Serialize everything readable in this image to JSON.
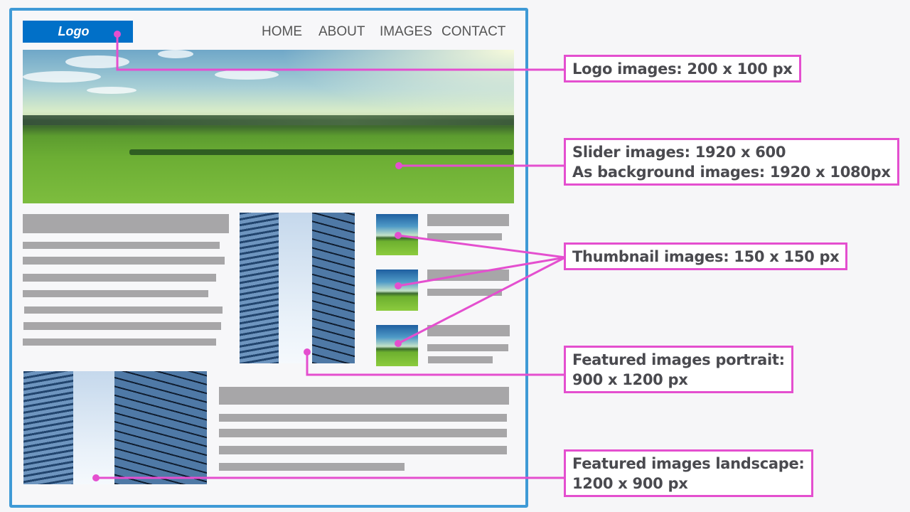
{
  "mockup": {
    "logo_label": "Logo",
    "nav": [
      "HOME",
      "ABOUT",
      "IMAGES",
      "CONTACT"
    ]
  },
  "annotations": {
    "logo": {
      "line1": "Logo images: 200 x 100 px"
    },
    "slider": {
      "line1": "Slider images: 1920 x 600",
      "line2": "As background images: 1920 x 1080px"
    },
    "thumbnail": {
      "line1": "Thumbnail images: 150 x 150 px"
    },
    "portrait": {
      "line1": "Featured images portrait:",
      "line2": "900 x 1200 px"
    },
    "landscape": {
      "line1": "Featured images landscape:",
      "line2": "1200 x 900 px"
    }
  },
  "colors": {
    "frame_border": "#3f9ad6",
    "logo_bg": "#0170c8",
    "annotation_pink": "#e44fcf",
    "placeholder_gray": "#a7a6a8",
    "annotation_text": "#4a4a4f"
  }
}
